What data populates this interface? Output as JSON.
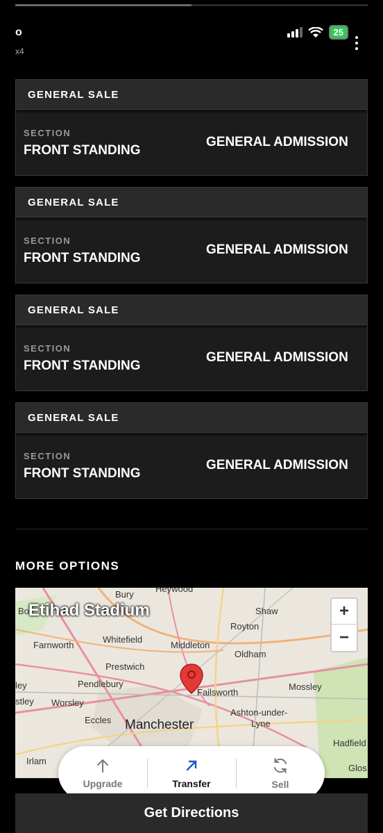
{
  "status_bar": {
    "time": "o",
    "subtitle": "x4",
    "battery": "25"
  },
  "tickets": [
    {
      "header": "GENERAL SALE",
      "section_label": "SECTION",
      "section_value": "FRONT STANDING",
      "admission": "GENERAL ADMISSION"
    },
    {
      "header": "GENERAL SALE",
      "section_label": "SECTION",
      "section_value": "FRONT STANDING",
      "admission": "GENERAL ADMISSION"
    },
    {
      "header": "GENERAL SALE",
      "section_label": "SECTION",
      "section_value": "FRONT STANDING",
      "admission": "GENERAL ADMISSION"
    },
    {
      "header": "GENERAL SALE",
      "section_label": "SECTION",
      "section_value": "FRONT STANDING",
      "admission": "GENERAL ADMISSION"
    }
  ],
  "more_options": {
    "title": "MORE OPTIONS"
  },
  "map": {
    "venue": "Etihad Stadium",
    "zoom_in": "+",
    "zoom_out": "−",
    "places": [
      "Bury",
      "Heywood",
      "Bo",
      "Shaw",
      "Royton",
      "Farnworth",
      "Whitefield",
      "Middleton",
      "Oldham",
      "Prestwich",
      "ley",
      "Pendlebury",
      "Failsworth",
      "Mossley",
      "stley",
      "Worsley",
      "Ashton-under-",
      "Lyne",
      "Eccles",
      "Manchester",
      "Hadfield",
      "Irlam",
      "Glos"
    ]
  },
  "actions": {
    "upgrade": "Upgrade",
    "transfer": "Transfer",
    "sell": "Sell"
  },
  "directions": {
    "label": "Get Directions"
  },
  "colors": {
    "accent_active": "#1a56c4",
    "pin": "#e53935",
    "battery": "#34c759"
  }
}
